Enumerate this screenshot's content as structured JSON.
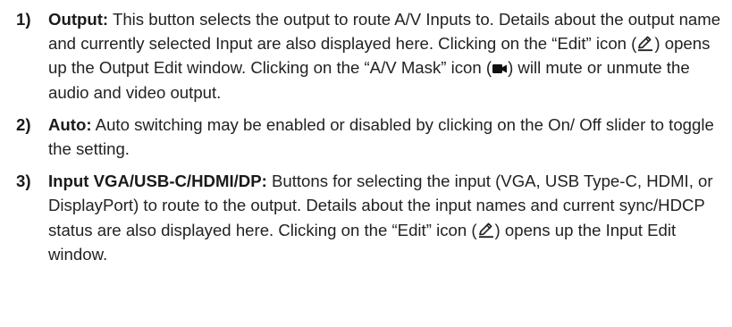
{
  "items": [
    {
      "number": "1)",
      "term": "Output:",
      "text_a": " This button selects the output to route A/V Inputs to. Details about the output name and currently selected Input are also displayed here. Clicking on the “Edit” icon (",
      "text_b": ") opens up the Output Edit window. Clicking on the “A/V Mask” icon (",
      "text_c": ") will mute or unmute the audio and video output.",
      "icons": [
        "edit-icon",
        "video-camera-icon"
      ]
    },
    {
      "number": "2)",
      "term": "Auto:",
      "text_a": " Auto switching may be enabled or disabled by clicking on the On/ Off slider to toggle the setting."
    },
    {
      "number": "3)",
      "term": "Input VGA/USB-C/HDMI/DP:",
      "text_a": " Buttons for selecting the input (VGA, USB Type-C, HDMI, or DisplayPort) to route to the output. Details about the input names and current sync/HDCP status are also displayed here. Clicking on the “Edit” icon (",
      "text_b": ") opens up the Input Edit window.",
      "icons": [
        "edit-icon"
      ]
    }
  ],
  "colors": {
    "text": "#222222",
    "heading": "#1a1a1a"
  }
}
